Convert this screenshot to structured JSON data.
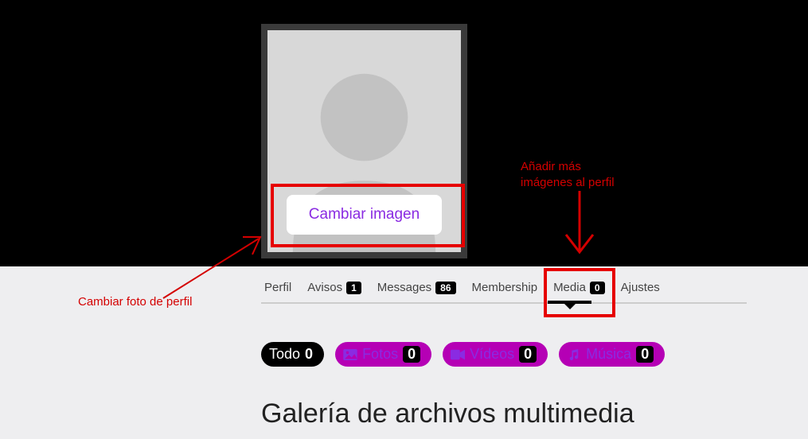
{
  "avatar": {
    "change_label": "Cambiar imagen"
  },
  "annotations": {
    "left": "Cambiar foto de perfil",
    "right": "Añadir más imágenes al perfil"
  },
  "tabs": {
    "perfil": "Perfil",
    "avisos_label": "Avisos",
    "avisos_count": "1",
    "messages_label": "Messages",
    "messages_count": "86",
    "membership": "Membership",
    "media_label": "Media",
    "media_count": "0",
    "ajustes": "Ajustes"
  },
  "filters": {
    "todo_label": "Todo",
    "todo_count": "0",
    "fotos_label": "Fotos",
    "fotos_count": "0",
    "videos_label": "Vídeos",
    "videos_count": "0",
    "musica_label": "Música",
    "musica_count": "0"
  },
  "gallery_title": "Galería de archivos multimedia"
}
